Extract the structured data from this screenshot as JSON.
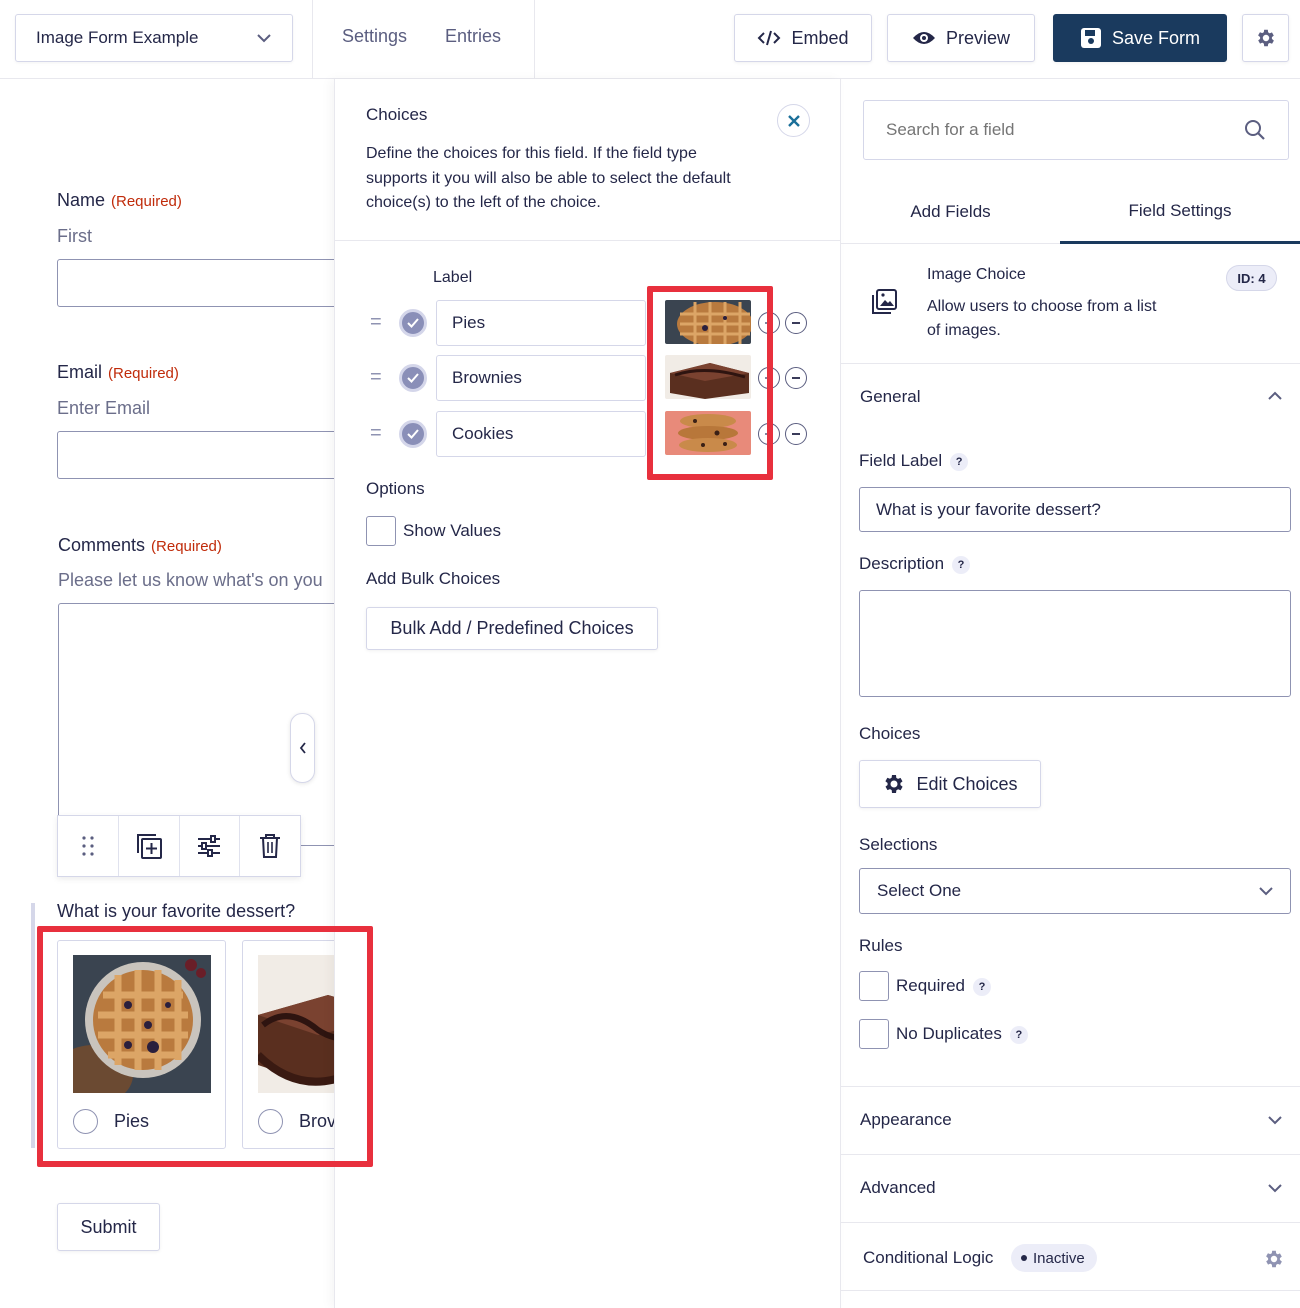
{
  "topbar": {
    "form_name": "Image Form Example",
    "links": [
      "Settings",
      "Entries"
    ],
    "embed_label": "Embed",
    "preview_label": "Preview",
    "save_label": "Save Form"
  },
  "form": {
    "name": {
      "label": "Name",
      "required": "(Required)",
      "sublabel": "First"
    },
    "email": {
      "label": "Email",
      "required": "(Required)",
      "sublabel": "Enter Email"
    },
    "comments": {
      "label": "Comments",
      "required": "(Required)",
      "description": "Please let us know what's on you"
    },
    "dessert": {
      "label": "What is your favorite dessert?",
      "choices": [
        "Pies",
        "Brov"
      ]
    },
    "submit_label": "Submit"
  },
  "choices_panel": {
    "title": "Choices",
    "description": "Define the choices for this field. If the field type supports it you will also be able to select the default choice(s) to the left of the choice.",
    "column_label": "Label",
    "items": [
      "Pies",
      "Brownies",
      "Cookies"
    ],
    "options_title": "Options",
    "show_values_label": "Show Values",
    "bulk_title": "Add Bulk Choices",
    "bulk_button": "Bulk Add / Predefined Choices"
  },
  "settings_panel": {
    "search_placeholder": "Search for a field",
    "tabs": [
      "Add Fields",
      "Field Settings"
    ],
    "field_type": {
      "title": "Image Choice",
      "description_line1": "Allow users to choose from a list",
      "description_line2": "of images.",
      "id_badge": "ID: 4"
    },
    "general_title": "General",
    "field_label_title": "Field Label",
    "field_label_value": "What is your favorite dessert?",
    "description_title": "Description",
    "choices_title": "Choices",
    "edit_choices_button": "Edit Choices",
    "selections_title": "Selections",
    "selections_value": "Select One",
    "rules_title": "Rules",
    "rules": [
      "Required",
      "No Duplicates"
    ],
    "appearance_title": "Appearance",
    "advanced_title": "Advanced",
    "conditional_logic_title": "Conditional Logic",
    "conditional_logic_status": "Inactive",
    "help_mark": "?"
  },
  "colors": {
    "primary": "#1a3a5e",
    "required": "#c02b0a",
    "highlight": "#e8303d",
    "text": "#242748",
    "tab_underline": "#1a3a5e"
  }
}
